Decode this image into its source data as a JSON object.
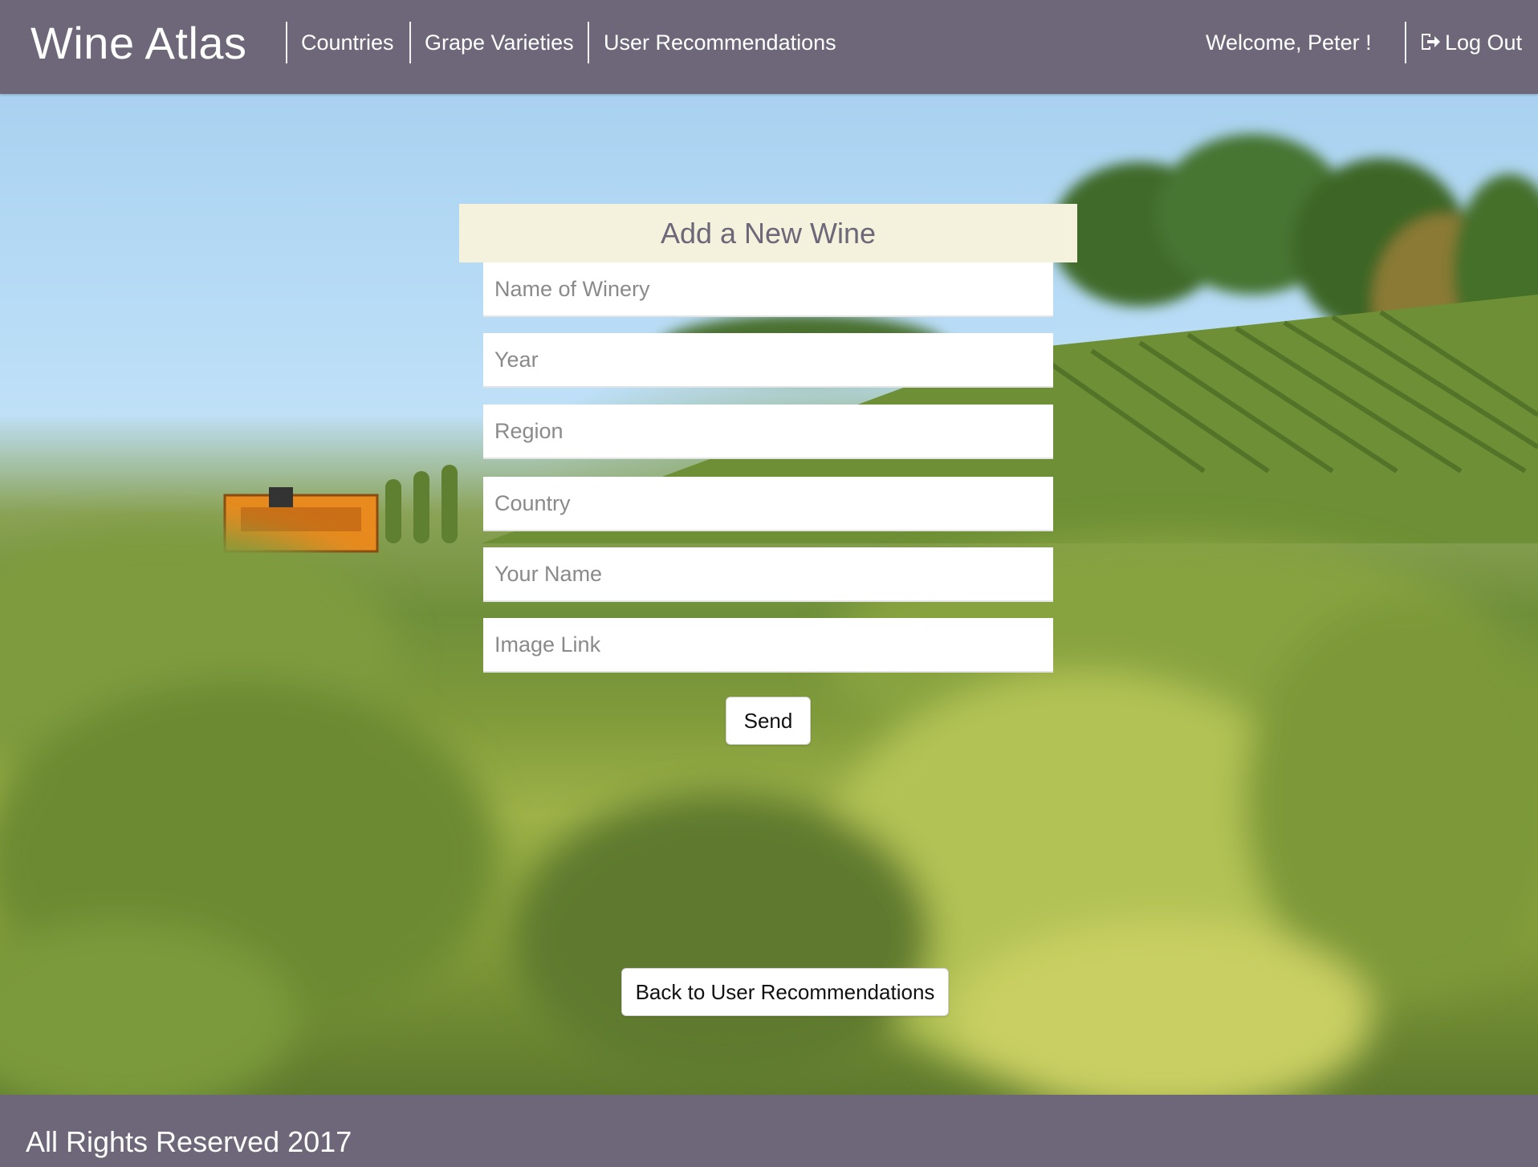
{
  "header": {
    "brand": "Wine Atlas",
    "nav": [
      {
        "label": "Countries"
      },
      {
        "label": "Grape Varieties"
      },
      {
        "label": "User Recommendations"
      }
    ],
    "welcome": "Welcome, Peter !",
    "logout_label": "Log Out",
    "logout_icon": "logout-icon"
  },
  "form": {
    "title": "Add a New Wine",
    "fields": [
      {
        "placeholder": "Name of Winery",
        "value": ""
      },
      {
        "placeholder": "Year",
        "value": ""
      },
      {
        "placeholder": "Region",
        "value": ""
      },
      {
        "placeholder": "Country",
        "value": ""
      },
      {
        "placeholder": "Your Name",
        "value": ""
      },
      {
        "placeholder": "Image Link",
        "value": ""
      }
    ],
    "send_label": "Send"
  },
  "back_label": "Back to User Recommendations",
  "footer": {
    "text": "All Rights Reserved 2017"
  },
  "colors": {
    "bar": "#6d6779",
    "form_header_bg": "#f4f2dc",
    "title_text": "#6d6779"
  }
}
